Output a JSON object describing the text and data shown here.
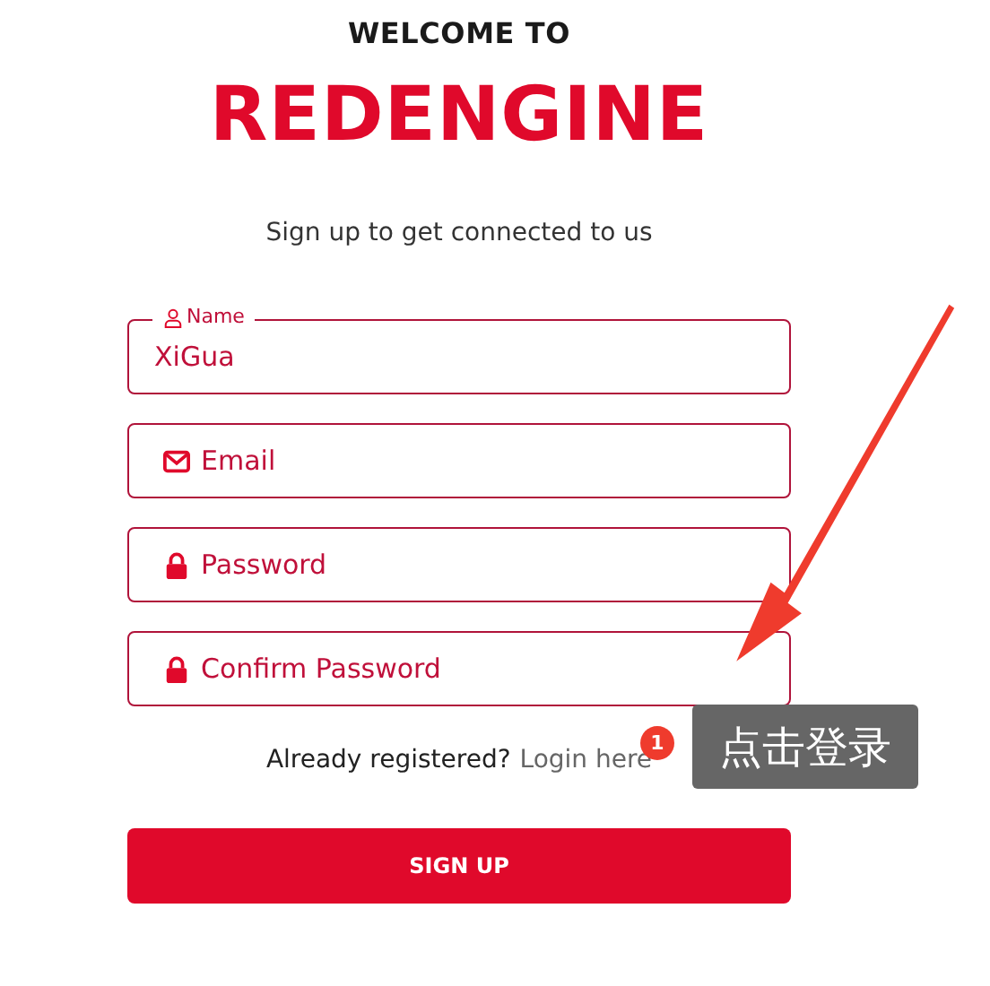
{
  "header": {
    "welcome": "WELCOME TO",
    "brand": "REDENGINE",
    "subtitle": "Sign up to get connected to us"
  },
  "fields": [
    {
      "kind": "name",
      "label": "Name",
      "value": "XiGua"
    },
    {
      "kind": "email",
      "placeholder": "Email"
    },
    {
      "kind": "password",
      "placeholder": "Password"
    },
    {
      "kind": "password",
      "placeholder": "Confirm Password"
    }
  ],
  "login_prompt": {
    "text": "Already registered?",
    "link": "Login here"
  },
  "submit": "SIGN UP",
  "annotation": {
    "step": "1",
    "text": "点击登录"
  }
}
